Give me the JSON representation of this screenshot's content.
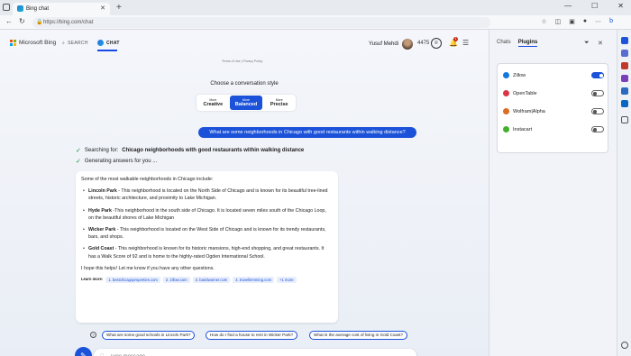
{
  "browser": {
    "tab_title": "Bing chat",
    "url": "https://bing.com/chat",
    "new_tab": "+"
  },
  "header": {
    "brand": "Microsoft Bing",
    "nav_search": "SEARCH",
    "nav_chat": "CHAT",
    "user_name": "Yusuf Mehdi",
    "points": "4475",
    "notification_count": "1"
  },
  "terms": "Terms of Use | Privacy Policy",
  "conversation_style": {
    "heading": "Choose a conversation style",
    "options": [
      {
        "prefix": "More",
        "label": "Creative"
      },
      {
        "prefix": "More",
        "label": "Balanced"
      },
      {
        "prefix": "More",
        "label": "Precise"
      }
    ],
    "selected": "Balanced"
  },
  "user_message": "What are some neighborhoods in Chicago with good restaurants within walking distance?",
  "status": {
    "searching_prefix": "Searching for:",
    "searching_query": "Chicago neighborhoods with good restaurants within walking distance",
    "generating": "Generating answers for you ..."
  },
  "answer": {
    "intro": "Some of the most walkable neighborhoods in Chicago include:",
    "items": [
      {
        "name": "Lincoln Park",
        "text": " - This neighborhood is located on the North Side of Chicago and is known for its beautiful tree-lined streets, historic architecture, and proximity to Lake Michigan."
      },
      {
        "name": "Hyde Park",
        "text": " -This neighborhood in the south side of Chicago. It is located seven miles south of the Chicago Loop, on the beautiful shores of Lake Michigan"
      },
      {
        "name": "Wicker Park",
        "text": " - This neighborhood is located on the West Side of Chicago and is known for its trendy restaurants, bars, and shops."
      },
      {
        "name": "Gold Coast",
        "text": " - This neighborhood is known for its historic mansions, high-end shopping, and great restaurants. It has a Walk Score of 92 and is home to the highly-rated Ogden International School."
      }
    ],
    "closing": "I hope this helps! Let me know if you have any other questions.",
    "learn_more_label": "Learn more:",
    "sources": [
      "1. bestchicagoproperties.com",
      "2. zillow.com",
      "3. bairdwarner.com",
      "4. travellemming.com",
      "+1 more"
    ]
  },
  "suggestions": [
    "What are some good schools in Lincoln Park?",
    "How do I find a house to rent in Wicker Park?",
    "What is the average cost of living in Gold Coast?"
  ],
  "input": {
    "placeholder": "Type message"
  },
  "panel": {
    "tab_chats": "Chats",
    "tab_plugins": "Plugins",
    "plugins": [
      {
        "name": "Zillow",
        "enabled": true,
        "color": "#1277e1"
      },
      {
        "name": "OpenTable",
        "enabled": false,
        "color": "#da3743"
      },
      {
        "name": "Wolfram|Alpha",
        "enabled": false,
        "color": "#dd6b20"
      },
      {
        "name": "Instacart",
        "enabled": false,
        "color": "#43b02a"
      }
    ]
  },
  "colors": {
    "accent": "#1b52d9",
    "check": "#138a3c"
  }
}
